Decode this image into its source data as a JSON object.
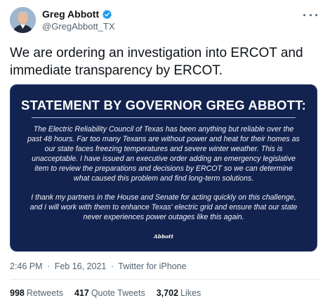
{
  "author": {
    "name": "Greg Abbott",
    "handle": "@GregAbbott_TX",
    "verified": true
  },
  "tweet_text": "We are ordering an investigation into ERCOT and immediate transparency by ERCOT.",
  "statement": {
    "title": "STATEMENT BY GOVERNOR GREG ABBOTT:",
    "paragraph_1": "The Electric Reliability Council of Texas has been anything but reliable over the past 48 hours. Far too many Texans are without power and heat for their homes as our state faces freezing temperatures and severe winter weather. This is unacceptable. I have issued an executive order adding an emergency legislative item to review the preparations and decisions by ERCOT so we can determine what caused this problem and find long-term solutions.",
    "paragraph_2": "I thank my partners in the House and Senate for acting quickly on this challenge, and I will work with them to enhance Texas' electric grid and ensure that our state never experiences power outages like this again.",
    "signature": "Abbott"
  },
  "meta": {
    "time": "2:46 PM",
    "separator": "·",
    "date": "Feb 16, 2021",
    "source": "Twitter for iPhone"
  },
  "stats": {
    "retweets_count": "998",
    "retweets_label": "Retweets",
    "quotes_count": "417",
    "quotes_label": "Quote Tweets",
    "likes_count": "3,702",
    "likes_label": "Likes"
  },
  "colors": {
    "card_background": "#13234f",
    "verified_badge": "#1d9bf0",
    "secondary_text": "#536471"
  }
}
